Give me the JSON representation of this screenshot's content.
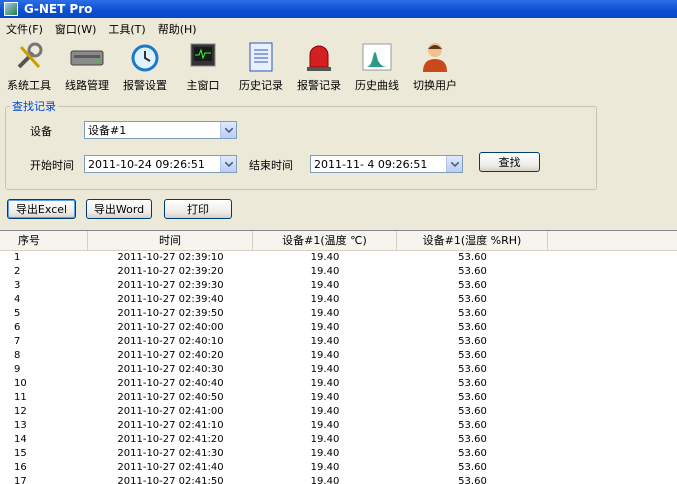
{
  "window": {
    "title": "G-NET Pro"
  },
  "menu": [
    "文件(F)",
    "窗口(W)",
    "工具(T)",
    "帮助(H)"
  ],
  "toolbar": [
    {
      "label": "系统工具",
      "icon": "tools-icon"
    },
    {
      "label": "线路管理",
      "icon": "router-icon"
    },
    {
      "label": "报警设置",
      "icon": "alarm-clock-icon"
    },
    {
      "label": "主窗口",
      "icon": "monitor-icon"
    },
    {
      "label": "历史记录",
      "icon": "document-icon"
    },
    {
      "label": "报警记录",
      "icon": "siren-icon"
    },
    {
      "label": "历史曲线",
      "icon": "chart-icon"
    },
    {
      "label": "切换用户",
      "icon": "user-icon"
    }
  ],
  "search": {
    "group_title": "查找记录",
    "device_label": "设备",
    "device_value": "设备#1",
    "start_label": "开始时间",
    "start_value": "2011-10-24 09:26:51",
    "end_label": "结束时间",
    "end_value": "2011-11-  4 09:26:51",
    "search_button": "查找"
  },
  "actions": {
    "export_excel": "导出Excel",
    "export_word": "导出Word",
    "print": "打印"
  },
  "table": {
    "columns": [
      "序号",
      "时间",
      "设备#1(温度 ℃)",
      "设备#1(湿度 %RH)"
    ],
    "rows": [
      [
        "1",
        "2011-10-27 02:39:10",
        "19.40",
        "53.60"
      ],
      [
        "2",
        "2011-10-27 02:39:20",
        "19.40",
        "53.60"
      ],
      [
        "3",
        "2011-10-27 02:39:30",
        "19.40",
        "53.60"
      ],
      [
        "4",
        "2011-10-27 02:39:40",
        "19.40",
        "53.60"
      ],
      [
        "5",
        "2011-10-27 02:39:50",
        "19.40",
        "53.60"
      ],
      [
        "6",
        "2011-10-27 02:40:00",
        "19.40",
        "53.60"
      ],
      [
        "7",
        "2011-10-27 02:40:10",
        "19.40",
        "53.60"
      ],
      [
        "8",
        "2011-10-27 02:40:20",
        "19.40",
        "53.60"
      ],
      [
        "9",
        "2011-10-27 02:40:30",
        "19.40",
        "53.60"
      ],
      [
        "10",
        "2011-10-27 02:40:40",
        "19.40",
        "53.60"
      ],
      [
        "11",
        "2011-10-27 02:40:50",
        "19.40",
        "53.60"
      ],
      [
        "12",
        "2011-10-27 02:41:00",
        "19.40",
        "53.60"
      ],
      [
        "13",
        "2011-10-27 02:41:10",
        "19.40",
        "53.60"
      ],
      [
        "14",
        "2011-10-27 02:41:20",
        "19.40",
        "53.60"
      ],
      [
        "15",
        "2011-10-27 02:41:30",
        "19.40",
        "53.60"
      ],
      [
        "16",
        "2011-10-27 02:41:40",
        "19.40",
        "53.60"
      ],
      [
        "17",
        "2011-10-27 02:41:50",
        "19.40",
        "53.60"
      ]
    ]
  }
}
